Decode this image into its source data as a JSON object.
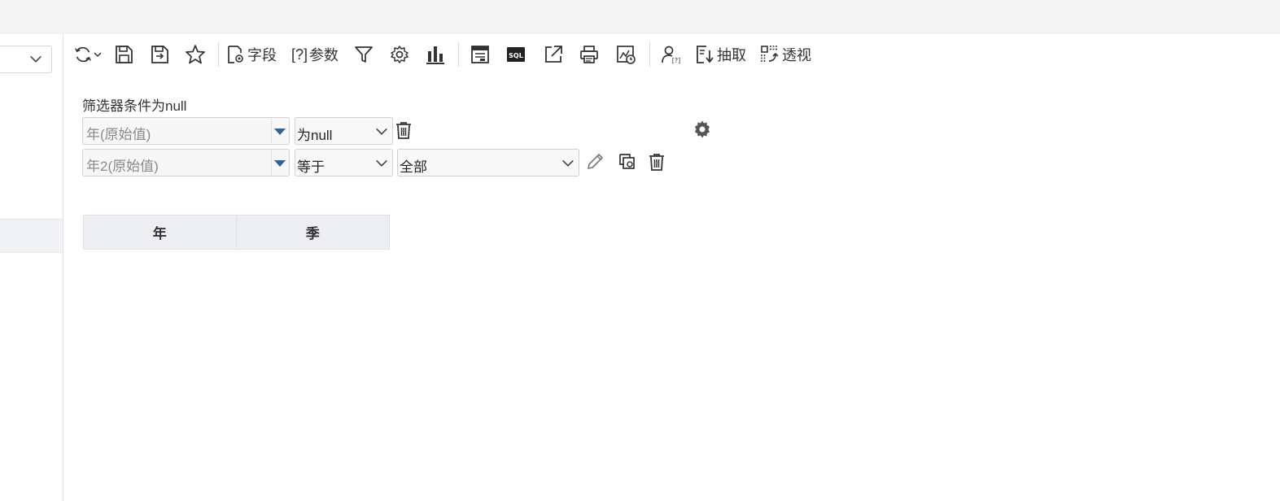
{
  "toolbar": {
    "field_label": "字段",
    "param_label": "参数",
    "extract_label": "抽取",
    "pivot_label": "透视"
  },
  "filter": {
    "title": "筛选器条件为null",
    "rows": [
      {
        "field": "年(原始值)",
        "operator": "为null"
      },
      {
        "field": "年2(原始值)",
        "operator": "等于",
        "value": "全部"
      }
    ]
  },
  "grid": {
    "headers": [
      "年",
      "季"
    ]
  },
  "colors": {
    "accent": "#2f6496",
    "header_bg": "#eceef1",
    "topbar_bg": "#f4f4f4"
  }
}
